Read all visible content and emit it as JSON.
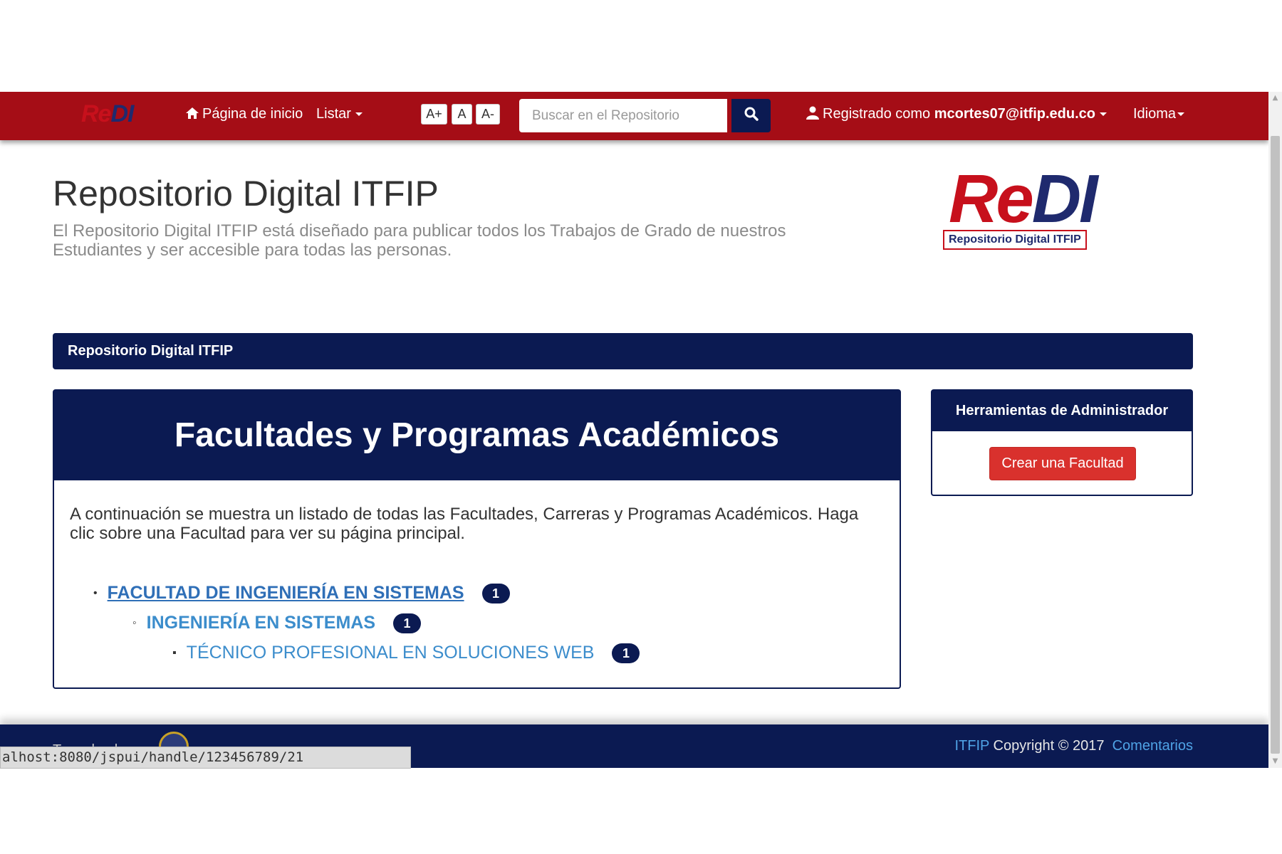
{
  "navbar": {
    "logo": {
      "re": "Re",
      "di": "DI"
    },
    "home_label": "Página de inicio",
    "browse_label": "Listar",
    "font_controls": {
      "increase": "A+",
      "normal": "A",
      "decrease": "A-"
    },
    "search_placeholder": "Buscar en el Repositorio",
    "user_prefix": "Registrado como",
    "user_email": "mcortes07@itfip.edu.co",
    "language_label": "Idioma",
    "background_color": "#a50d16"
  },
  "header": {
    "title": "Repositorio Digital ITFIP",
    "intro": "El Repositorio Digital ITFIP está diseñado para publicar todos los Trabajos de Grado de nuestros Estudiantes y ser accesible para todas las personas.",
    "logo": {
      "re": "Re",
      "di": "DI",
      "subtitle": "Repositorio Digital ITFIP"
    }
  },
  "breadcrumb": {
    "current": "Repositorio Digital ITFIP"
  },
  "main": {
    "heading": "Facultades y Programas Académicos",
    "description": "A continuación se muestra un listado de todas las Facultades, Carreras y Programas Académicos. Haga clic sobre una Facultad para ver su página principal.",
    "tree": [
      {
        "level": 1,
        "name": "FACULTAD DE INGENIERÍA EN SISTEMAS",
        "count": "1"
      },
      {
        "level": 2,
        "name": "INGENIERÍA EN SISTEMAS",
        "count": "1"
      },
      {
        "level": 3,
        "name": "TÉCNICO PROFESIONAL EN SOLUCIONES WEB",
        "count": "1"
      }
    ]
  },
  "admin": {
    "heading": "Herramientas de Administrador",
    "create_button": "Crear una Facultad"
  },
  "footer": {
    "theme_label": "Tema hecho por",
    "org_link": "ITFIP",
    "copyright": "Copyright © 2017",
    "feedback_link": "Comentarios"
  },
  "status_bar": {
    "url": "alhost:8080/jspui/handle/123456789/21"
  },
  "colors": {
    "primary": "#0b1a52",
    "accent_red": "#d9312d",
    "link": "#3c8dcc"
  }
}
